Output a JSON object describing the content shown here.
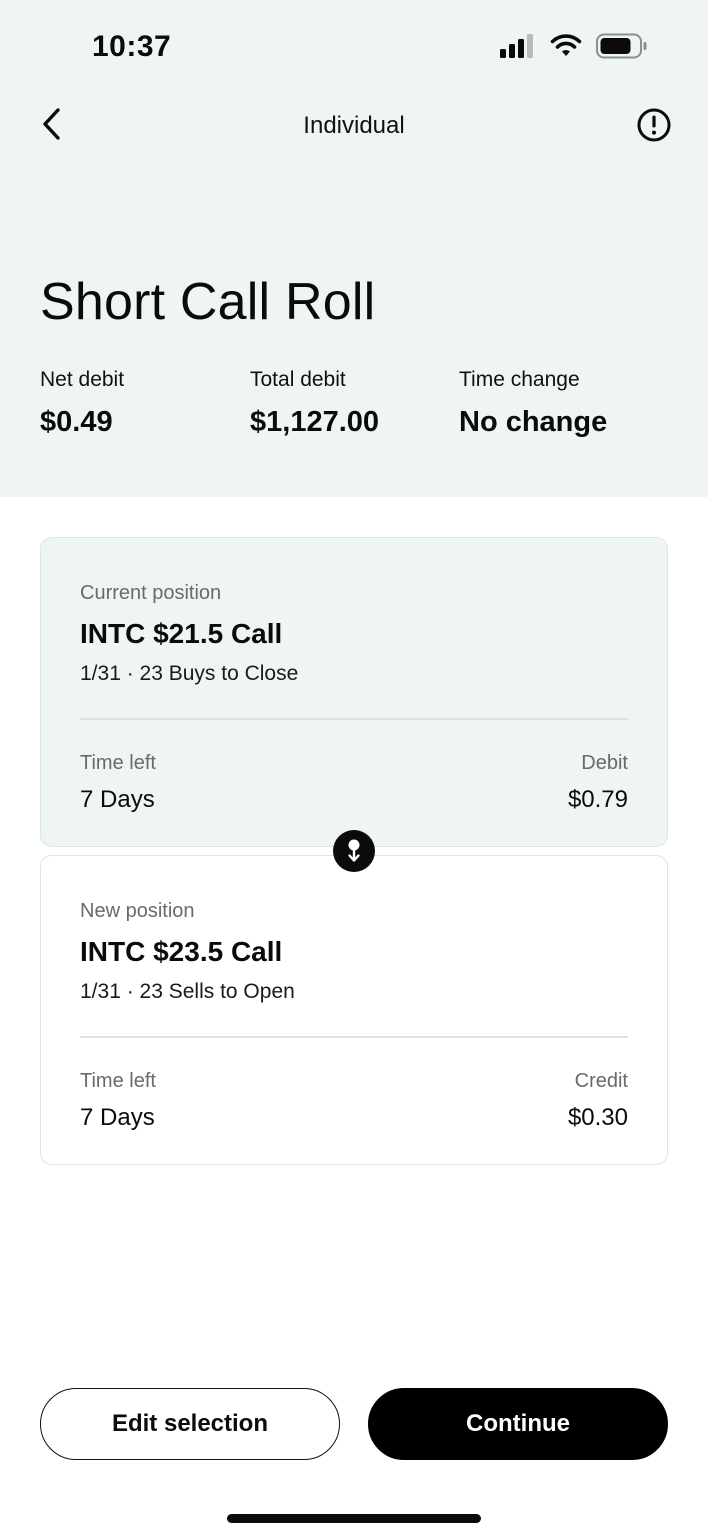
{
  "status_bar": {
    "time": "10:37",
    "icons": [
      "cellular-signal-icon",
      "wifi-icon",
      "battery-icon"
    ]
  },
  "nav": {
    "back_icon": "chevron-left-icon",
    "title": "Individual",
    "info_icon": "exclamation-circle-icon"
  },
  "header": {
    "title": "Short Call Roll",
    "stats": [
      {
        "label": "Net debit",
        "value": "$0.49"
      },
      {
        "label": "Total debit",
        "value": "$1,127.00"
      },
      {
        "label": "Time change",
        "value": "No change"
      }
    ]
  },
  "current_position": {
    "caption": "Current position",
    "symbol": "INTC $21.5 Call",
    "detail": "1/31 · 23 Buys to Close",
    "time_left_label": "Time left",
    "time_left_value": "7 Days",
    "amount_label": "Debit",
    "amount_value": "$0.79"
  },
  "roll_icon": "arrow-down-icon",
  "new_position": {
    "caption": "New position",
    "symbol": "INTC $23.5 Call",
    "detail": "1/31 · 23 Sells to Open",
    "time_left_label": "Time left",
    "time_left_value": "7 Days",
    "amount_label": "Credit",
    "amount_value": "$0.30"
  },
  "actions": {
    "edit_label": "Edit selection",
    "continue_label": "Continue"
  },
  "colors": {
    "header_bg": "#eff5f5",
    "primary": "#000000",
    "muted_text": "#666b6b",
    "card_border": "#dbe6e6"
  }
}
